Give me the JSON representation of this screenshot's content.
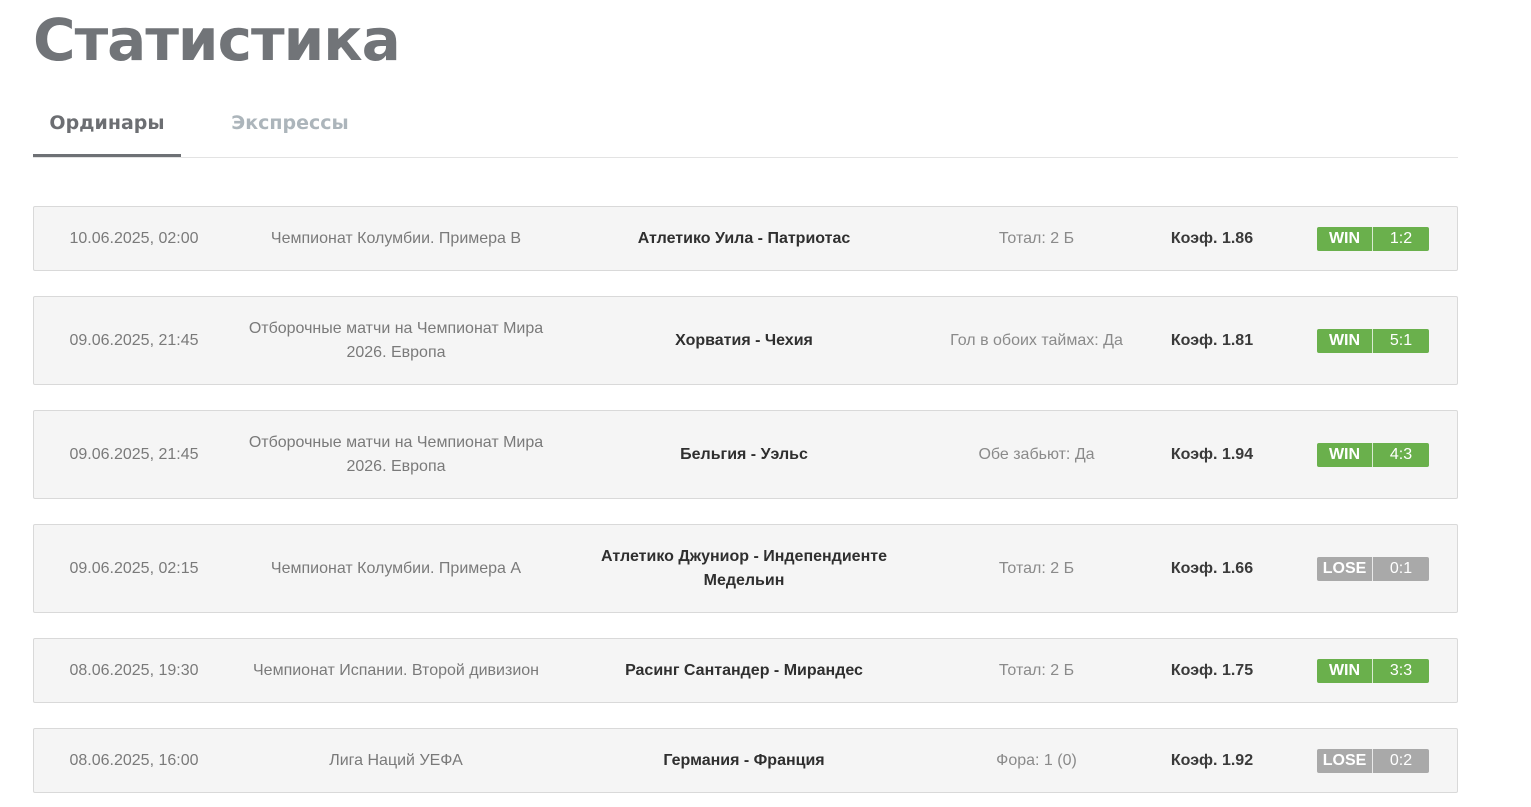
{
  "page": {
    "title": "Статистика"
  },
  "tabs": [
    {
      "label": "Ординары",
      "active": true
    },
    {
      "label": "Экспрессы",
      "active": false
    }
  ],
  "coef_prefix": "Коэф.",
  "colors": {
    "win": "#6ab04c",
    "lose": "#a9a9a9",
    "title": "#717478"
  },
  "bets": [
    {
      "date": "10.06.2025, 02:00",
      "league": "Чемпионат Колумбии. Примера B",
      "match": "Атлетико Уила - Патриотас",
      "market": "Тотал: 2 Б",
      "coef": "Коэф. 1.86",
      "result": "WIN",
      "score": "1:2"
    },
    {
      "date": "09.06.2025, 21:45",
      "league": "Отборочные матчи на Чемпионат Мира 2026. Европа",
      "match": "Хорватия - Чехия",
      "market": "Гол в обоих таймах: Да",
      "coef": "Коэф. 1.81",
      "result": "WIN",
      "score": "5:1"
    },
    {
      "date": "09.06.2025, 21:45",
      "league": "Отборочные матчи на Чемпионат Мира 2026. Европа",
      "match": "Бельгия - Уэльс",
      "market": "Обе забьют: Да",
      "coef": "Коэф. 1.94",
      "result": "WIN",
      "score": "4:3"
    },
    {
      "date": "09.06.2025, 02:15",
      "league": "Чемпионат Колумбии. Примера A",
      "match": "Атлетико Джуниор - Индепендиенте Медельин",
      "market": "Тотал: 2 Б",
      "coef": "Коэф. 1.66",
      "result": "LOSE",
      "score": "0:1"
    },
    {
      "date": "08.06.2025, 19:30",
      "league": "Чемпионат Испании. Второй дивизион",
      "match": "Расинг Сантандер - Мирандес",
      "market": "Тотал: 2 Б",
      "coef": "Коэф. 1.75",
      "result": "WIN",
      "score": "3:3"
    },
    {
      "date": "08.06.2025, 16:00",
      "league": "Лига Наций УЕФА",
      "match": "Германия - Франция",
      "market": "Фора: 1 (0)",
      "coef": "Коэф. 1.92",
      "result": "LOSE",
      "score": "0:2"
    }
  ]
}
